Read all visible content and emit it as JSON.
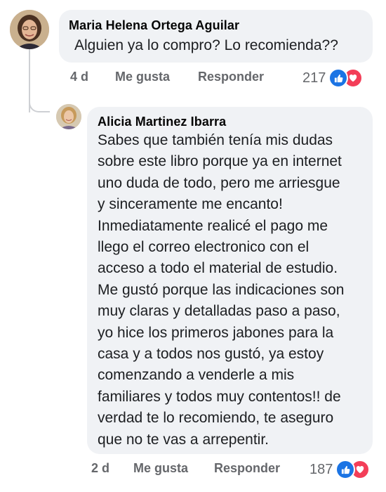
{
  "comments": [
    {
      "author": "Maria Helena Ortega Aguilar",
      "lines": [
        "Alguien ya lo compro? Lo recomienda??"
      ],
      "time": "4 d",
      "like_label": "Me gusta",
      "reply_label": "Responder",
      "reaction_count": "217",
      "reactions": [
        "like-icon",
        "heart-icon"
      ]
    },
    {
      "author": "Alicia Martinez Ibarra",
      "lines": [
        "Sabes que también tenía mis dudas",
        "sobre este libro porque ya en internet",
        "uno duda de todo, pero me arriesgue",
        "y sinceramente me encanto!",
        "Inmediatamente realicé el pago me",
        "llego el correo electronico con el",
        "acceso a todo el material de estudio.",
        "Me gustó porque las indicaciones son",
        "muy claras y detalladas paso a paso,",
        "yo hice los primeros jabones para la",
        "casa y a todos nos gustó, ya estoy",
        "comenzando a venderle a mis",
        "familiares y todos muy contentos!! de",
        "verdad te lo recomiendo, te aseguro",
        "que no te vas a arrepentir."
      ],
      "time": "2 d",
      "like_label": "Me gusta",
      "reply_label": "Responder",
      "reaction_count": "187",
      "reactions": [
        "like-icon",
        "heart-icon"
      ]
    }
  ],
  "colors": {
    "bubble": "#f0f2f5",
    "meta_text": "#65676b",
    "like_blue": "#1b74e4",
    "love_red": "#f33e58",
    "thread_line": "#ced0d4"
  }
}
